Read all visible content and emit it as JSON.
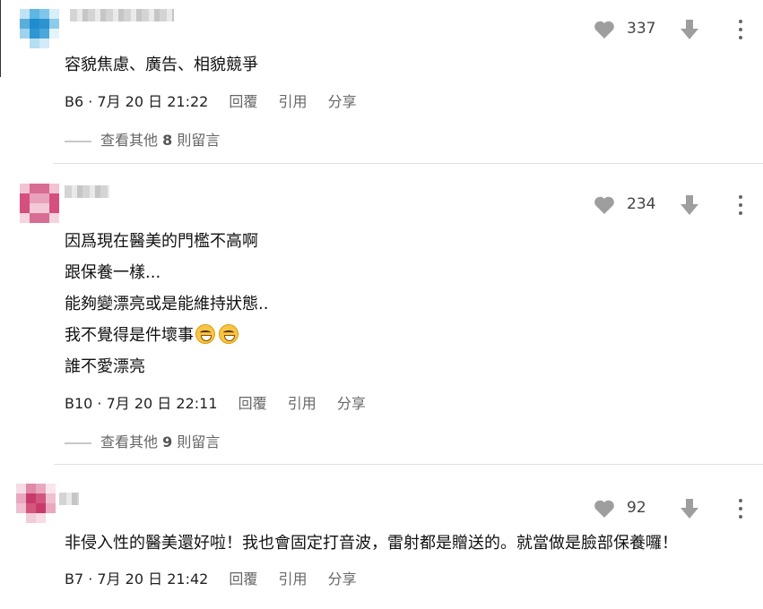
{
  "comments": [
    {
      "lines": [
        "容貌焦慮、廣告、相貌競爭"
      ],
      "meta": "B6 · 7月 20 日 21:22",
      "reply": "回覆",
      "quote": "引用",
      "share": "分享",
      "likes": "337",
      "more_prefix": "查看其他",
      "more_count": "8",
      "more_suffix": "則留言"
    },
    {
      "lines": [
        "因爲現在醫美的門檻不高啊",
        "跟保養一樣...",
        "能夠變漂亮或是能維持狀態..",
        "我不覺得是件壞事",
        "誰不愛漂亮"
      ],
      "meta": "B10 · 7月 20 日 22:11",
      "reply": "回覆",
      "quote": "引用",
      "share": "分享",
      "likes": "234",
      "more_prefix": "查看其他",
      "more_count": "9",
      "more_suffix": "則留言"
    },
    {
      "lines": [
        "非侵入性的醫美還好啦！我也會固定打音波，雷射都是贈送的。就當做是臉部保養囉！"
      ],
      "meta": "B7 · 7月 20 日 21:42",
      "reply": "回覆",
      "quote": "引用",
      "share": "分享",
      "likes": "92"
    }
  ],
  "icons": {
    "like": "heart-icon",
    "dislike": "arrow-down-icon",
    "menu": "more-vertical-icon",
    "emoji": "grinning-squinting-face-emoji"
  },
  "colors": {
    "icon_gray": "#9e9e9e",
    "avatar_blue": "#3aa0d8",
    "avatar_pink": "#d23c6e"
  }
}
